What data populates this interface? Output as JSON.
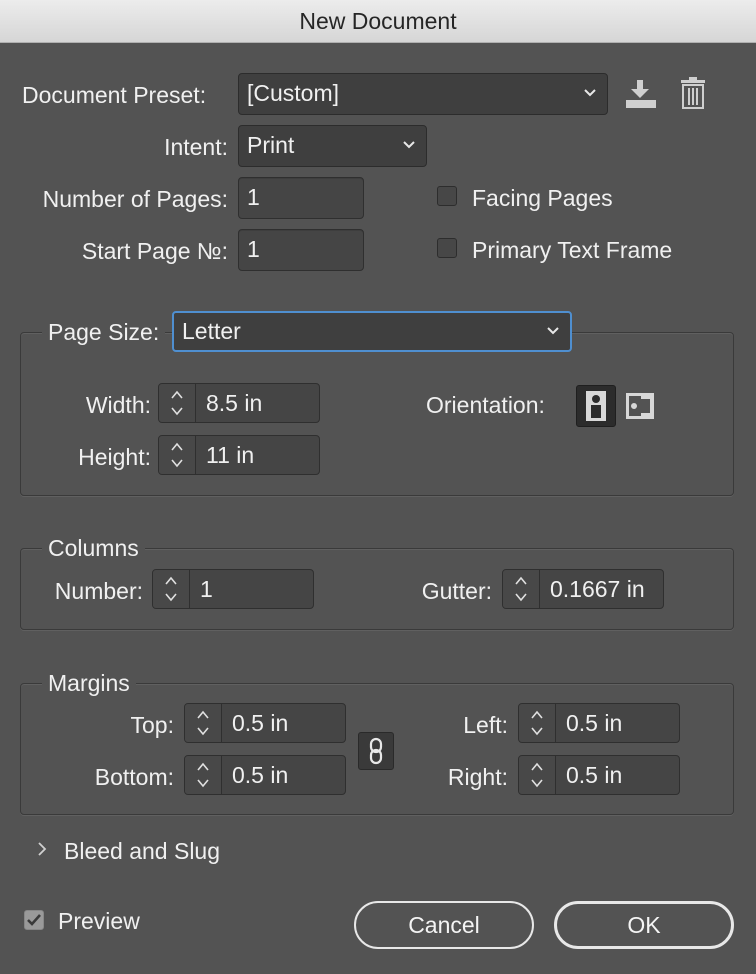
{
  "window": {
    "title": "New Document"
  },
  "preset": {
    "label": "Document Preset:",
    "value": "[Custom]"
  },
  "intent": {
    "label": "Intent:",
    "value": "Print"
  },
  "pages": {
    "count_label": "Number of Pages:",
    "count_value": "1",
    "start_label": "Start Page №:",
    "start_value": "1",
    "facing_label": "Facing Pages",
    "facing_checked": false,
    "primary_text_frame_label": "Primary Text Frame",
    "primary_text_frame_checked": false
  },
  "page_size": {
    "label": "Page Size:",
    "value": "Letter",
    "width_label": "Width:",
    "width_value": "8.5 in",
    "height_label": "Height:",
    "height_value": "11 in",
    "orientation_label": "Orientation:",
    "orientation_selected": "portrait"
  },
  "columns": {
    "legend": "Columns",
    "number_label": "Number:",
    "number_value": "1",
    "gutter_label": "Gutter:",
    "gutter_value": "0.1667 in"
  },
  "margins": {
    "legend": "Margins",
    "top_label": "Top:",
    "top_value": "0.5 in",
    "bottom_label": "Bottom:",
    "bottom_value": "0.5 in",
    "left_label": "Left:",
    "left_value": "0.5 in",
    "right_label": "Right:",
    "right_value": "0.5 in"
  },
  "bleed": {
    "label": "Bleed and Slug"
  },
  "preview": {
    "label": "Preview",
    "checked": true
  },
  "buttons": {
    "cancel": "Cancel",
    "ok": "OK"
  }
}
